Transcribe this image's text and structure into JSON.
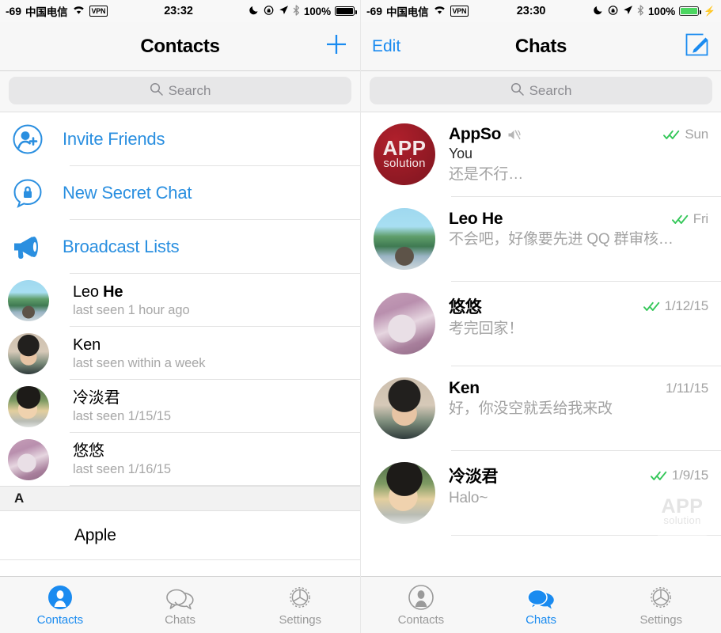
{
  "left": {
    "status_bar": {
      "signal": "-69",
      "carrier": "中国电信",
      "wifi_icon": "wifi-icon",
      "vpn": "VPN",
      "time": "23:32",
      "dnd_icon": "moon-icon",
      "rotation_lock_icon": "rotation-lock-icon",
      "location_icon": "location-arrow-icon",
      "bluetooth_icon": "bluetooth-icon",
      "battery_percent": "100%",
      "battery_state": "full"
    },
    "navbar": {
      "title": "Contacts",
      "right_icon": "plus-icon"
    },
    "search": {
      "placeholder": "Search",
      "icon": "search-icon"
    },
    "actions": [
      {
        "label": "Invite Friends",
        "icon": "add-person-icon"
      },
      {
        "label": "New Secret Chat",
        "icon": "lock-chat-icon"
      },
      {
        "label": "Broadcast Lists",
        "icon": "megaphone-icon"
      }
    ],
    "contacts": [
      {
        "first": "Leo ",
        "last": "He",
        "status": "last seen 1 hour ago",
        "avatar": "ph-leo"
      },
      {
        "first": "Ken",
        "last": "",
        "status": "last seen within a week",
        "avatar": "ph-ken"
      },
      {
        "first": "冷淡君",
        "last": "",
        "status": "last seen 1/15/15",
        "avatar": "ph-leng"
      },
      {
        "first": "悠悠",
        "last": "",
        "status": "last seen 1/16/15",
        "avatar": "ph-cat"
      }
    ],
    "section": {
      "letter": "A",
      "rows": [
        {
          "name": "Apple"
        }
      ]
    },
    "tabs": [
      {
        "label": "Contacts",
        "icon": "person-icon",
        "active": true
      },
      {
        "label": "Chats",
        "icon": "chat-bubbles-icon",
        "active": false
      },
      {
        "label": "Settings",
        "icon": "gear-icon",
        "active": false
      }
    ]
  },
  "right": {
    "status_bar": {
      "signal": "-69",
      "carrier": "中国电信",
      "wifi_icon": "wifi-icon",
      "vpn": "VPN",
      "time": "23:30",
      "dnd_icon": "moon-icon",
      "rotation_lock_icon": "rotation-lock-icon",
      "location_icon": "location-arrow-icon",
      "bluetooth_icon": "bluetooth-icon",
      "battery_percent": "100%",
      "battery_state": "charging"
    },
    "navbar": {
      "left_label": "Edit",
      "title": "Chats",
      "right_icon": "compose-icon"
    },
    "search": {
      "placeholder": "Search",
      "icon": "search-icon"
    },
    "chats": [
      {
        "name": "AppSo",
        "muted": true,
        "sender": "You",
        "preview": "还是不行…",
        "ticks": true,
        "date": "Sun",
        "avatar": "ph-appso"
      },
      {
        "name": "Leo He",
        "muted": false,
        "sender": "",
        "preview": "不会吧，好像要先进 QQ 群审核…",
        "ticks": true,
        "date": "Fri",
        "avatar": "ph-leo"
      },
      {
        "name": "悠悠",
        "muted": false,
        "sender": "",
        "preview": "考完回家！",
        "ticks": true,
        "date": "1/12/15",
        "avatar": "ph-cat"
      },
      {
        "name": "Ken",
        "muted": false,
        "sender": "",
        "preview": "好，你没空就丢给我来改",
        "ticks": false,
        "date": "1/11/15",
        "avatar": "ph-ken"
      },
      {
        "name": "冷淡君",
        "muted": false,
        "sender": "",
        "preview": "Halo~",
        "ticks": true,
        "date": "1/9/15",
        "avatar": "ph-leng"
      }
    ],
    "watermark": {
      "line1": "APP",
      "line2": "solution"
    },
    "tabs": [
      {
        "label": "Contacts",
        "icon": "person-icon",
        "active": false
      },
      {
        "label": "Chats",
        "icon": "chat-bubbles-icon",
        "active": true
      },
      {
        "label": "Settings",
        "icon": "gear-icon",
        "active": false
      }
    ]
  },
  "colors": {
    "accent": "#1a8bf0",
    "tick_green": "#34c759",
    "muted_gray": "#a3a3a3",
    "appso_red": "#9a1b26"
  }
}
